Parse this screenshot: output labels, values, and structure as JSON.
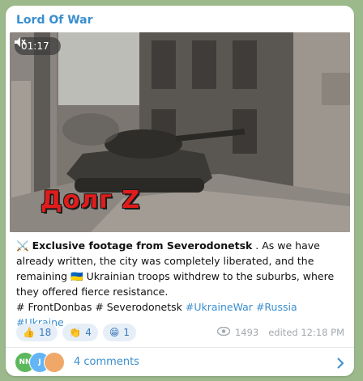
{
  "post": {
    "channel": "Lord Of War",
    "video": {
      "duration": "01:17",
      "overlay_caption": "Долг Z"
    },
    "message": {
      "emoji_swords": "⚔️",
      "headline": "Exclusive footage from Severodonetsk",
      "body_part1": " . As we have already written, the city was completely liberated, and the remaining ",
      "flag": "🇺🇦",
      "body_part2": " Ukrainian troops withdrew to the suburbs, where they offered fierce resistance.",
      "tags_plain": "# FrontDonbas # Severodonetsk",
      "hashtags": [
        "#UkraineWar",
        "#Russia",
        "#Ukraine"
      ]
    },
    "reactions": [
      {
        "emoji": "👍",
        "count": "18"
      },
      {
        "emoji": "👏",
        "count": "4"
      },
      {
        "emoji": "😁",
        "count": "1"
      }
    ],
    "views": "1493",
    "edited": "edited 12:18 PM",
    "comments": {
      "label": "4 comments",
      "avatars": [
        {
          "initials": "NN",
          "color": "#5cb85c"
        },
        {
          "initials": "J",
          "color": "#64b5f6"
        },
        {
          "initials": "",
          "color": "#f0a868"
        }
      ]
    }
  },
  "colors": {
    "accent": "#3a8ecf",
    "background": "#9bb98a",
    "overlay_red": "#e01c1c"
  }
}
